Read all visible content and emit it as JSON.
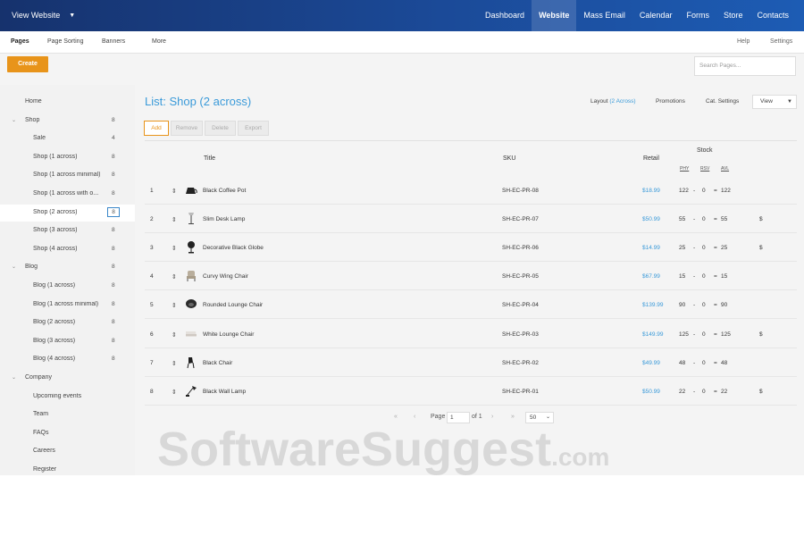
{
  "topbar": {
    "view_website": "View Website",
    "nav": [
      "Dashboard",
      "Website",
      "Mass Email",
      "Calendar",
      "Forms",
      "Store",
      "Contacts"
    ],
    "active_nav": "Website",
    "background": "#1b4a98"
  },
  "subnav": {
    "tabs": [
      "Pages",
      "Page Sorting",
      "Banners",
      "More"
    ],
    "active_tab": "Pages",
    "help": "Help",
    "settings": "Settings"
  },
  "toolbar": {
    "create_label": "Create",
    "search_placeholder": "Search Pages..."
  },
  "sidebar": {
    "items": [
      {
        "label": "Home",
        "count": "",
        "toggle": ""
      },
      {
        "label": "Shop",
        "count": "8",
        "toggle": "⌄"
      },
      {
        "label": "Sale",
        "count": "4",
        "toggle": ""
      },
      {
        "label": "Shop (1 across)",
        "count": "8",
        "toggle": ""
      },
      {
        "label": "Shop (1 across minimal)",
        "count": "8",
        "toggle": ""
      },
      {
        "label": "Shop (1 across with o...",
        "count": "8",
        "toggle": ""
      },
      {
        "label": "Shop (2 across)",
        "count": "8",
        "toggle": ""
      },
      {
        "label": "Shop (3 across)",
        "count": "8",
        "toggle": ""
      },
      {
        "label": "Shop (4 across)",
        "count": "8",
        "toggle": ""
      },
      {
        "label": "Blog",
        "count": "8",
        "toggle": "⌄"
      },
      {
        "label": "Blog (1 across)",
        "count": "8",
        "toggle": ""
      },
      {
        "label": "Blog (1 across minimal)",
        "count": "8",
        "toggle": ""
      },
      {
        "label": "Blog (2 across)",
        "count": "8",
        "toggle": ""
      },
      {
        "label": "Blog (3 across)",
        "count": "8",
        "toggle": ""
      },
      {
        "label": "Blog (4 across)",
        "count": "8",
        "toggle": ""
      },
      {
        "label": "Company",
        "count": "",
        "toggle": "⌄"
      },
      {
        "label": "Upcoming events",
        "count": "",
        "toggle": ""
      },
      {
        "label": "Team",
        "count": "",
        "toggle": ""
      },
      {
        "label": "FAQs",
        "count": "",
        "toggle": ""
      },
      {
        "label": "Careers",
        "count": "",
        "toggle": ""
      },
      {
        "label": "Register",
        "count": "",
        "toggle": ""
      }
    ],
    "selected": "Shop (2 across)"
  },
  "main": {
    "list_title": "List: Shop (2 across)",
    "layout_label": "Layout",
    "layout_value": "(2 Across)",
    "promotions": "Promotions",
    "cat_settings": "Cat. Settings",
    "view_label": "View",
    "buttons": [
      "Add",
      "Remove",
      "Delete",
      "Export"
    ],
    "columns": {
      "title": "Title",
      "sku": "SKU",
      "retail": "Retail",
      "stock": "Stock",
      "stock_sub": [
        "PHY",
        "RSV",
        "AVL"
      ]
    },
    "rows": [
      {
        "num": "1",
        "title": "Black Coffee Pot",
        "sku": "SH-EC-PR-08",
        "retail": "$18.99",
        "phy": "122",
        "rsv": "0",
        "avl": "122",
        "flag": ""
      },
      {
        "num": "2",
        "title": "Slim Desk Lamp",
        "sku": "SH-EC-PR-07",
        "retail": "$50.99",
        "phy": "55",
        "rsv": "0",
        "avl": "55",
        "flag": "$"
      },
      {
        "num": "3",
        "title": "Decorative Black Globe",
        "sku": "SH-EC-PR-06",
        "retail": "$14.99",
        "phy": "25",
        "rsv": "0",
        "avl": "25",
        "flag": "$"
      },
      {
        "num": "4",
        "title": "Curvy Wing Chair",
        "sku": "SH-EC-PR-05",
        "retail": "$67.99",
        "phy": "15",
        "rsv": "0",
        "avl": "15",
        "flag": ""
      },
      {
        "num": "5",
        "title": "Rounded Lounge Chair",
        "sku": "SH-EC-PR-04",
        "retail": "$139.99",
        "phy": "90",
        "rsv": "0",
        "avl": "90",
        "flag": ""
      },
      {
        "num": "6",
        "title": "White Lounge Chair",
        "sku": "SH-EC-PR-03",
        "retail": "$149.99",
        "phy": "125",
        "rsv": "0",
        "avl": "125",
        "flag": "$"
      },
      {
        "num": "7",
        "title": "Black Chair",
        "sku": "SH-EC-PR-02",
        "retail": "$49.99",
        "phy": "48",
        "rsv": "0",
        "avl": "48",
        "flag": ""
      },
      {
        "num": "8",
        "title": "Black Wall Lamp",
        "sku": "SH-EC-PR-01",
        "retail": "$50.99",
        "phy": "22",
        "rsv": "0",
        "avl": "22",
        "flag": "$"
      }
    ],
    "pagination": {
      "first": "«",
      "prev": "‹",
      "page_label": "Page",
      "page_value": "1",
      "of_label": "of 1",
      "next": "›",
      "last": "»",
      "page_size": "50"
    }
  },
  "watermark": {
    "main": "SoftwareSuggest",
    "suffix": ".com"
  }
}
